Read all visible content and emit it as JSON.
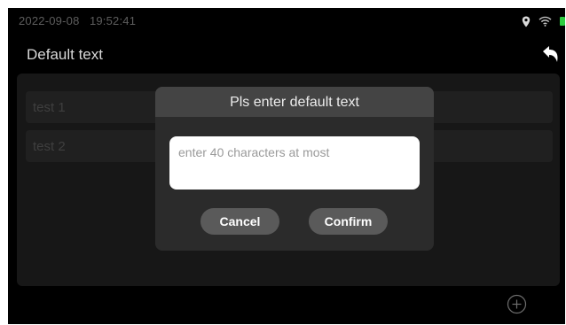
{
  "status_bar": {
    "date": "2022-09-08",
    "time": "19:52:41",
    "icons": [
      "location-icon",
      "wifi-icon",
      "battery-icon"
    ],
    "battery_color": "#2ecc40"
  },
  "header": {
    "title": "Default text",
    "back_icon": "undo-arrow-icon"
  },
  "list": {
    "items": [
      {
        "label": "test 1"
      },
      {
        "label": "test 2"
      }
    ]
  },
  "footer": {
    "add_icon": "plus-circle-icon"
  },
  "dialog": {
    "title": "Pls enter default text",
    "input_value": "",
    "input_placeholder": "enter 40 characters at most",
    "cancel_label": "Cancel",
    "confirm_label": "Confirm"
  },
  "colors": {
    "background": "#000000",
    "dialog_bg": "#2b2b2b",
    "dialog_header_bg": "#444444",
    "button_bg": "#5a5a5a"
  }
}
